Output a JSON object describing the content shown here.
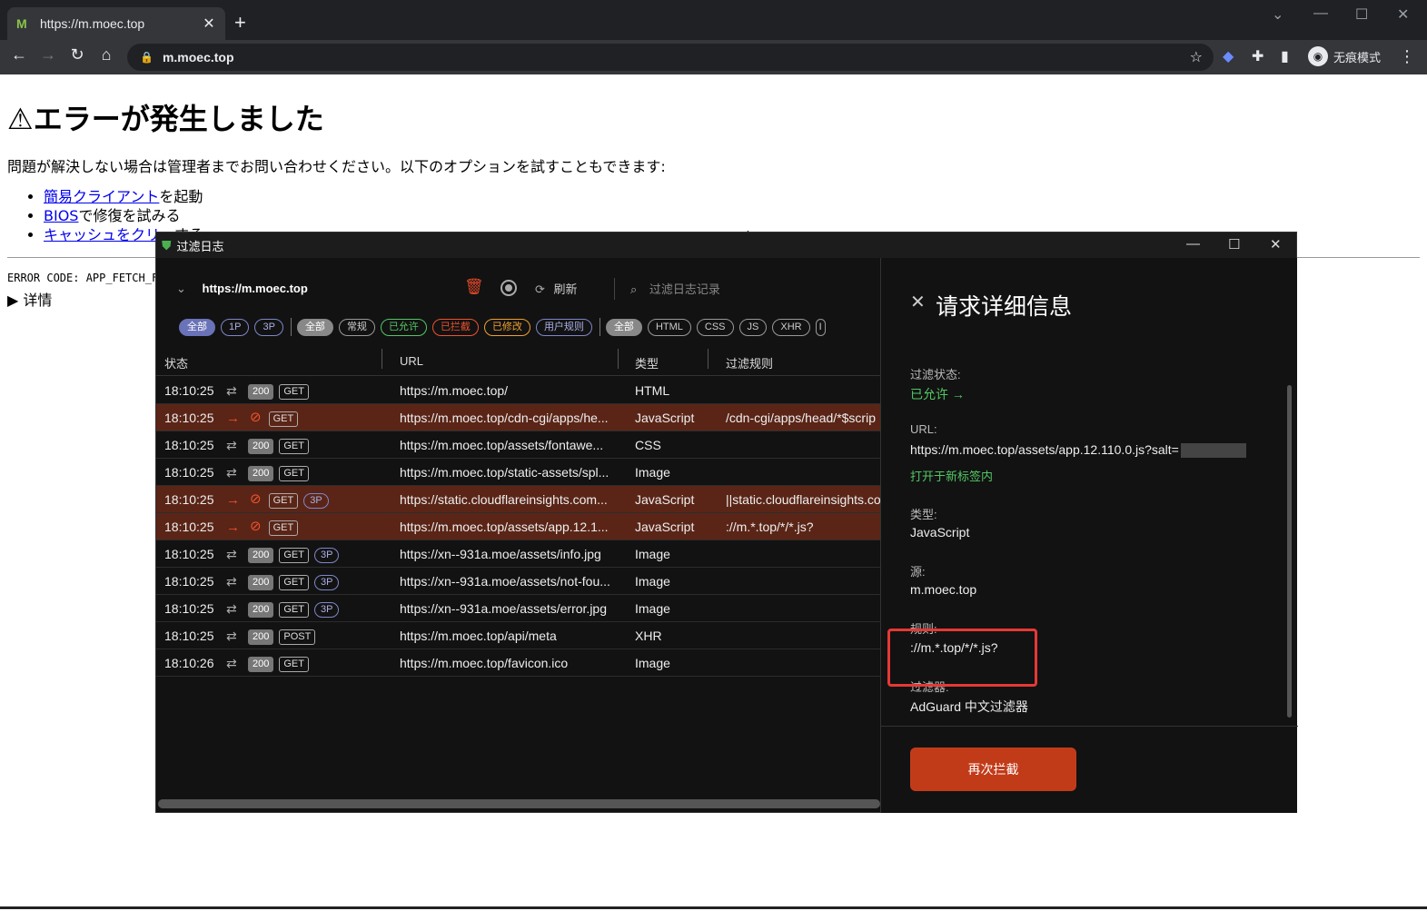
{
  "browser": {
    "tab_title": "https://m.moec.top",
    "address": "m.moec.top",
    "incognito_label": "无痕模式"
  },
  "page": {
    "heading": "⚠エラーが発生しました",
    "description": "問題が解決しない場合は管理者までお問い合わせください。以下のオプションを試すこともできます:",
    "options": [
      {
        "link": "簡易クライアント",
        "rest": "を起動"
      },
      {
        "link": "BIOS",
        "rest": "で修復を試みる"
      },
      {
        "link": "キャッシュをクリ",
        "rest": "ーする"
      }
    ],
    "error_code": "ERROR CODE: APP_FETCH_FA",
    "details": "▶ 详情"
  },
  "filter_log": {
    "window_title": "过滤日志",
    "site": "https://m.moec.top",
    "refresh_label": "刷新",
    "search_placeholder": "过滤日志记录",
    "chips": {
      "party": [
        "全部",
        "1P",
        "3P"
      ],
      "status": [
        "全部",
        "常规",
        "已允许",
        "已拦截",
        "已修改",
        "用户规则"
      ],
      "types": [
        "全部",
        "HTML",
        "CSS",
        "JS",
        "XHR",
        "I"
      ]
    },
    "colors": {
      "blocked_row": "#5a2517",
      "allowed": "#52c764",
      "blocked": "#f0522e",
      "modified": "#f0a030",
      "user_rule": "#7e86c9",
      "accent_button": "#c23b19"
    },
    "columns": [
      "状态",
      "URL",
      "类型",
      "过滤规则"
    ],
    "rows": [
      {
        "time": "18:10:25",
        "blocked": false,
        "code": "200",
        "method": "GET",
        "third_party": "",
        "url": "https://m.moec.top/",
        "type": "HTML",
        "rule": ""
      },
      {
        "time": "18:10:25",
        "blocked": true,
        "code": "",
        "method": "GET",
        "third_party": "",
        "url": "https://m.moec.top/cdn-cgi/apps/he...",
        "type": "JavaScript",
        "rule": "/cdn-cgi/apps/head/*$scrip"
      },
      {
        "time": "18:10:25",
        "blocked": false,
        "code": "200",
        "method": "GET",
        "third_party": "",
        "url": "https://m.moec.top/assets/fontawe...",
        "type": "CSS",
        "rule": ""
      },
      {
        "time": "18:10:25",
        "blocked": false,
        "code": "200",
        "method": "GET",
        "third_party": "",
        "url": "https://m.moec.top/static-assets/spl...",
        "type": "Image",
        "rule": ""
      },
      {
        "time": "18:10:25",
        "blocked": true,
        "code": "",
        "method": "GET",
        "third_party": "3P",
        "url": "https://static.cloudflareinsights.com...",
        "type": "JavaScript",
        "rule": "||static.cloudflareinsights.co"
      },
      {
        "time": "18:10:25",
        "blocked": true,
        "code": "",
        "method": "GET",
        "third_party": "",
        "url": "https://m.moec.top/assets/app.12.1...",
        "type": "JavaScript",
        "rule": "://m.*.top/*/*.js?"
      },
      {
        "time": "18:10:25",
        "blocked": false,
        "code": "200",
        "method": "GET",
        "third_party": "3P",
        "url": "https://xn--931a.moe/assets/info.jpg",
        "type": "Image",
        "rule": ""
      },
      {
        "time": "18:10:25",
        "blocked": false,
        "code": "200",
        "method": "GET",
        "third_party": "3P",
        "url": "https://xn--931a.moe/assets/not-fou...",
        "type": "Image",
        "rule": ""
      },
      {
        "time": "18:10:25",
        "blocked": false,
        "code": "200",
        "method": "GET",
        "third_party": "3P",
        "url": "https://xn--931a.moe/assets/error.jpg",
        "type": "Image",
        "rule": ""
      },
      {
        "time": "18:10:25",
        "blocked": false,
        "code": "200",
        "method": "POST",
        "third_party": "",
        "url": "https://m.moec.top/api/meta",
        "type": "XHR",
        "rule": ""
      },
      {
        "time": "18:10:26",
        "blocked": false,
        "code": "200",
        "method": "GET",
        "third_party": "",
        "url": "https://m.moec.top/favicon.ico",
        "type": "Image",
        "rule": ""
      }
    ],
    "detail": {
      "title": "请求详细信息",
      "status_label": "过滤状态:",
      "status_value": "已允许 →",
      "url_label": "URL:",
      "url_value": "https://m.moec.top/assets/app.12.110.0.js?salt=",
      "open_new_tab": "打开于新标签内",
      "type_label": "类型:",
      "type_value": "JavaScript",
      "source_label": "源:",
      "source_value": "m.moec.top",
      "rule_label": "规则:",
      "rule_value": "://m.*.top/*/*.js?",
      "filter_label": "过滤器:",
      "filter_value": "AdGuard 中文过滤器",
      "reblock_button": "再次拦截"
    }
  }
}
